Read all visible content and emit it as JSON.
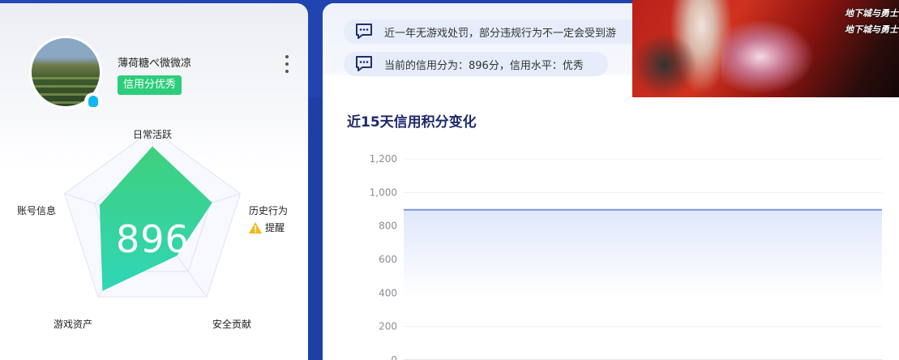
{
  "profile": {
    "username": "薄荷糖ぺ微微凉",
    "credit_tag": "信用分优秀"
  },
  "radar": {
    "score": "896",
    "labels": {
      "top": "日常活跃",
      "right": "历史行为",
      "bottom_right": "安全贡献",
      "bottom_left": "游戏资产",
      "left": "账号信息"
    },
    "warning_label": "提醒",
    "colors": {
      "fill_top": "#3fd07c",
      "fill_bottom": "#2fd6b8",
      "grid": "#dfe2f2"
    }
  },
  "notices": [
    {
      "text": "近一年无游戏处罚，部分违规行为不一定会受到游"
    },
    {
      "text": "当前的信用分为：896分，信用水平：优秀"
    }
  ],
  "chart_title": "近15天信用积分变化",
  "chart_data": {
    "type": "area",
    "title": "近15天信用积分变化",
    "ylim": [
      0,
      1200
    ],
    "yticks": [
      "0",
      "200",
      "400",
      "600",
      "800",
      "1,000",
      "1,200"
    ],
    "series": [
      {
        "values": [
          896,
          896,
          896,
          896,
          896,
          896,
          896,
          896,
          896,
          896,
          896,
          896,
          896,
          896,
          896
        ]
      }
    ],
    "grid": true,
    "line_color": "#7c97d6"
  },
  "ad": {
    "logo_text": "地下城与勇士"
  }
}
